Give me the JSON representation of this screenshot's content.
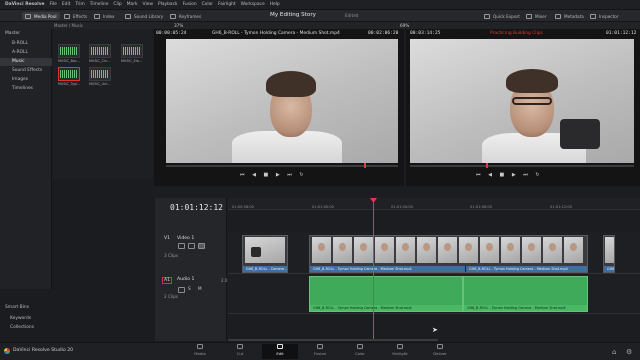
{
  "menu": [
    "DaVinci Resolve",
    "File",
    "Edit",
    "Trim",
    "Timeline",
    "Clip",
    "Mark",
    "View",
    "Playback",
    "Fusion",
    "Color",
    "Fairlight",
    "Workspace",
    "Help"
  ],
  "toolbar": {
    "media_pool": "Media Pool",
    "effects": "Effects",
    "index": "Index",
    "sound_library": "Sound Library",
    "keyframes": "Keyframes",
    "quick_export": "Quick Export",
    "mixer": "Mixer",
    "metadata": "Metadata",
    "inspector": "Inspector"
  },
  "project": {
    "title": "My Editing Story",
    "status": "Edited"
  },
  "path": "Master / Music",
  "zoom": {
    "left": "37%",
    "right": "69%"
  },
  "bins": [
    "Master",
    "B-ROLL",
    "A-ROLL",
    "Music",
    "Sound Effects",
    "Images",
    "Timelines"
  ],
  "smart_bins": {
    "title": "Smart Bins",
    "items": [
      "Keywords",
      "Collections"
    ]
  },
  "clips": [
    {
      "name": "MUSIC_Bac..."
    },
    {
      "name": "MUSIC_Cin..."
    },
    {
      "name": "MUSIC_Ele..."
    },
    {
      "name": "MUSIC_Typi..."
    },
    {
      "name": "MUSIC_Uni..."
    }
  ],
  "source": {
    "in": "00:00:05:24",
    "title": "GH6_B-ROLL - Tymon Holding Camera - Medium Shot.mp4",
    "out": "00:02:06:20"
  },
  "program": {
    "tc_left": "00:03:14:25",
    "title": "Practicing Building Clips",
    "tc_right": "01:01:12:12"
  },
  "timeline": {
    "timecode": "01:01:12:12",
    "ruler": [
      "01:00:56:00",
      "01:01:00:00",
      "01:01:04:00",
      "01:01:08:00",
      "01:01:12:00"
    ]
  },
  "tracks": {
    "v1": {
      "id": "V1",
      "name": "Video 1",
      "count": "3 Clips"
    },
    "a1": {
      "id": "A1",
      "name": "Audio 1",
      "count": "2 Clips",
      "level": "2.0"
    }
  },
  "video_clips": [
    "GH6_B-ROLL - Camera ...",
    "GH6_B-ROLL - Tymon Holding Camera - Medium Shot.mp4",
    "GH6_B-ROLL - Tymon Holding Camera - Medium Shot.mp4",
    "GH6"
  ],
  "audio_clips": [
    "GH6_B-ROLL - Tymon Holding Camera - Medium Shot.mp4",
    "GH6_B-ROLL - Tymon Holding Camera - Medium Shot.mp4"
  ],
  "pages": [
    "Media",
    "Cut",
    "Edit",
    "Fusion",
    "Color",
    "Fairlight",
    "Deliver"
  ],
  "footer": {
    "app": "DaVinci Resolve Studio 20"
  },
  "accents": {
    "playhead": "#e03a3a",
    "audio": "#3faa5a",
    "video": "#3d6fa3",
    "active": "#e8e8e8"
  }
}
